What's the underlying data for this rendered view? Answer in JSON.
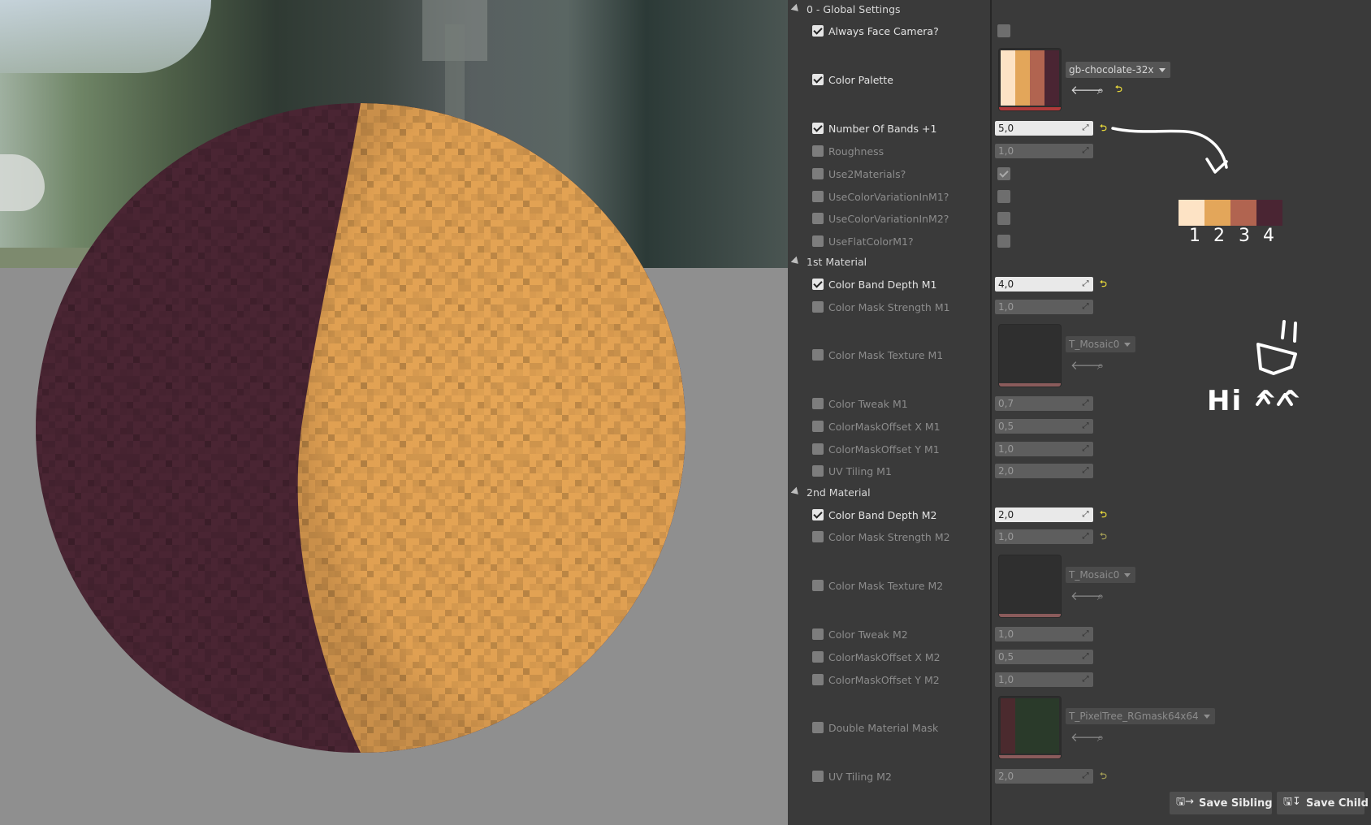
{
  "categories": {
    "global": "0 - Global Settings",
    "first": "1st Material",
    "second": "2nd Material"
  },
  "properties": {
    "always_face_camera": "Always Face Camera?",
    "color_palette": "Color Palette",
    "number_of_bands": "Number Of Bands +1",
    "roughness": "Roughness",
    "use2materials": "Use2Materials?",
    "use_color_variation_m1": "UseColorVariationInM1?",
    "use_color_variation_m2": "UseColorVariationInM2?",
    "use_flat_color_m1": "UseFlatColorM1?",
    "color_band_depth_m1": "Color Band Depth M1",
    "color_mask_strength_m1": "Color Mask Strength M1",
    "color_mask_texture_m1": "Color Mask Texture M1",
    "color_tweak_m1": "Color Tweak M1",
    "color_mask_offset_x_m1": "ColorMaskOffset X M1",
    "color_mask_offset_y_m1": "ColorMaskOffset Y M1",
    "uv_tiling_m1": "UV Tiling M1",
    "color_band_depth_m2": "Color Band Depth M2",
    "color_mask_strength_m2": "Color Mask Strength M2",
    "color_mask_texture_m2": "Color Mask Texture M2",
    "color_tweak_m2": "Color Tweak M2",
    "color_mask_offset_x_m2": "ColorMaskOffset X M2",
    "color_mask_offset_y_m2": "ColorMaskOffset Y M2",
    "double_material_mask": "Double Material Mask",
    "uv_tiling_m2": "UV Tiling M2"
  },
  "values": {
    "number_of_bands": "5,0",
    "roughness": "1,0",
    "color_band_depth_m1": "4,0",
    "color_mask_strength_m1": "1,0",
    "color_tweak_m1": "0,7",
    "color_mask_offset_x_m1": "0,5",
    "color_mask_offset_y_m1": "1,0",
    "uv_tiling_m1": "2,0",
    "color_band_depth_m2": "2,0",
    "color_mask_strength_m2": "1,0",
    "color_tweak_m2": "1,0",
    "color_mask_offset_x_m2": "0,5",
    "color_mask_offset_y_m2": "1,0",
    "uv_tiling_m2": "2,0"
  },
  "assets": {
    "palette": "gb-chocolate-32x",
    "mask_texture_m1": "T_Mosaic0",
    "mask_texture_m2": "T_Mosaic0",
    "double_mask": "T_PixelTree_RGmask64x64"
  },
  "palette_colors": [
    "#fde3c5",
    "#e3a65a",
    "#b16450",
    "#4a2533"
  ],
  "annotation": {
    "numbers": [
      "1",
      "2",
      "3",
      "4"
    ],
    "hi": "Hi ^^"
  },
  "buttons": {
    "save_sibling": "Save Sibling",
    "save_child": "Save Child"
  },
  "icons": {
    "browse": "arrow-left-icon",
    "find": "search-icon",
    "reset": "reset-arrow-icon",
    "save": "save-icon",
    "expand": "expand-icon"
  }
}
